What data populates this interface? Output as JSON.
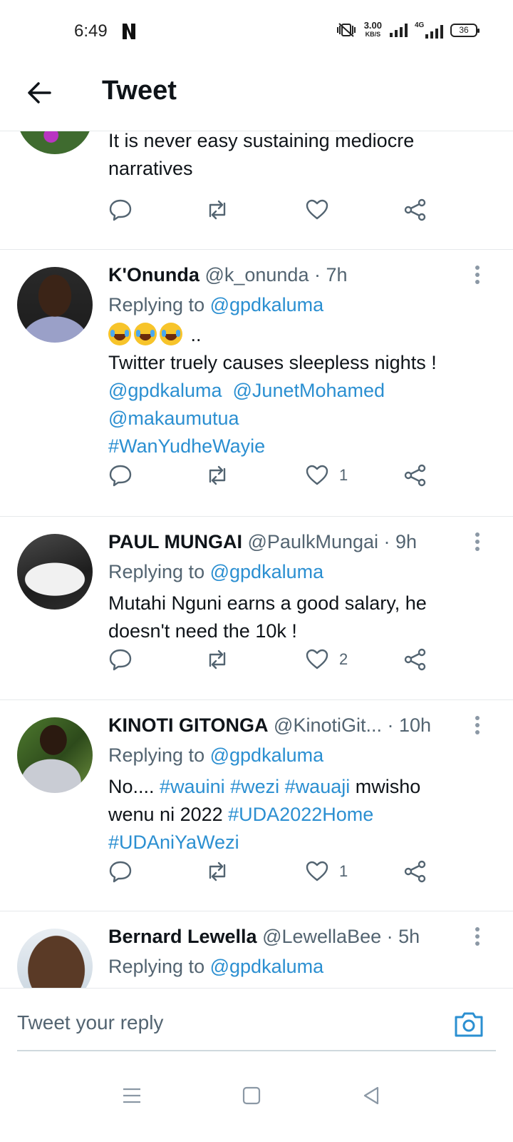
{
  "status_bar": {
    "time": "6:49",
    "speed_value": "3.00",
    "speed_unit": "KB/S",
    "network": "4G",
    "battery": "36"
  },
  "header": {
    "title": "Tweet"
  },
  "partial_tweet": {
    "body": "It is never easy sustaining mediocre narratives"
  },
  "tweets": [
    {
      "name": "K'Onunda",
      "handle": "@k_onunda",
      "time": "· 7h",
      "replying_prefix": "Replying to",
      "replying_to": "@gpdkaluma",
      "emoji_suffix": "..",
      "body_text": "Twitter truely causes sleepless nights !",
      "mentions": [
        "@gpdkaluma",
        "@JunetMohamed",
        "@makaumutua"
      ],
      "hashtag": "#WanYudheWayie",
      "likes": "1"
    },
    {
      "name": "PAUL MUNGAI",
      "handle": "@PaulkMungai",
      "time": "· 9h",
      "replying_prefix": "Replying to",
      "replying_to": "@gpdkaluma",
      "body_text": "Mutahi Nguni earns a good salary, he doesn't need the 10k !",
      "likes": "2"
    },
    {
      "name": "KINOTI  GITONGA",
      "handle": "@KinotiGit...",
      "time": "· 10h",
      "replying_prefix": "Replying to",
      "replying_to": "@gpdkaluma",
      "body_parts": [
        "No....",
        "#wauini",
        "#wezi",
        "#wauaji",
        "mwisho",
        "wenu ni 2022",
        "#UDA2022Home",
        "#UDAniYaWezi"
      ],
      "likes": "1"
    },
    {
      "name": "Bernard Lewella",
      "handle": "@LewellaBee",
      "time": "· 5h",
      "replying_prefix": "Replying to",
      "replying_to": "@gpdkaluma"
    }
  ],
  "reply_bar": {
    "placeholder": "Tweet your reply"
  },
  "colors": {
    "link": "#2b8fd1",
    "text": "#0f1419",
    "muted": "#536471"
  }
}
